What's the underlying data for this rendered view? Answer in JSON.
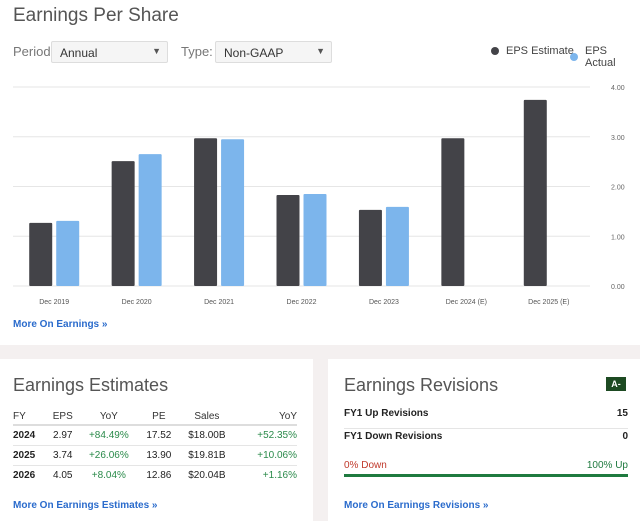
{
  "eps": {
    "title": "Earnings Per Share",
    "period_label": "Period:",
    "period_value": "Annual",
    "type_label": "Type:",
    "type_value": "Non-GAAP",
    "more_link": "More On Earnings »"
  },
  "chart_data": {
    "type": "bar",
    "title": "Earnings Per Share",
    "categories": [
      "Dec 2019",
      "Dec 2020",
      "Dec 2021",
      "Dec 2022",
      "Dec 2023",
      "Dec 2024 (E)",
      "Dec 2025 (E)"
    ],
    "series": [
      {
        "name": "EPS Estimate",
        "color": "#434348",
        "values": [
          1.27,
          2.51,
          2.97,
          1.83,
          1.53,
          2.97,
          3.74
        ]
      },
      {
        "name": "EPS Actual",
        "color": "#7cb5ec",
        "values": [
          1.31,
          2.65,
          2.95,
          1.85,
          1.59,
          null,
          null
        ]
      }
    ],
    "yticks": [
      "0.00",
      "1.00",
      "2.00",
      "3.00",
      "4.00"
    ],
    "ylim": [
      0,
      4
    ],
    "grid": true,
    "legend": "top-right",
    "yaxis_side": "right"
  },
  "estimates": {
    "title": "Earnings Estimates",
    "headers": [
      "FY",
      "EPS",
      "YoY",
      "PE",
      "Sales",
      "YoY"
    ],
    "rows": [
      [
        "2024",
        "2.97",
        "+84.49%",
        "17.52",
        "$18.00B",
        "+52.35%"
      ],
      [
        "2025",
        "3.74",
        "+26.06%",
        "13.90",
        "$19.81B",
        "+10.06%"
      ],
      [
        "2026",
        "4.05",
        "+8.04%",
        "12.86",
        "$20.04B",
        "+1.16%"
      ]
    ],
    "more_link": "More On Earnings Estimates »"
  },
  "revisions": {
    "title": "Earnings Revisions",
    "grade": "A-",
    "up_label": "FY1 Up Revisions",
    "up_value": "15",
    "down_label": "FY1 Down Revisions",
    "down_value": "0",
    "down_pct_label": "0% Down",
    "up_pct_label": "100% Up",
    "up_fraction": 1.0,
    "colors": {
      "up": "#1f7a3f",
      "down": "#c0392b"
    },
    "more_link": "More On Earnings Revisions »"
  }
}
